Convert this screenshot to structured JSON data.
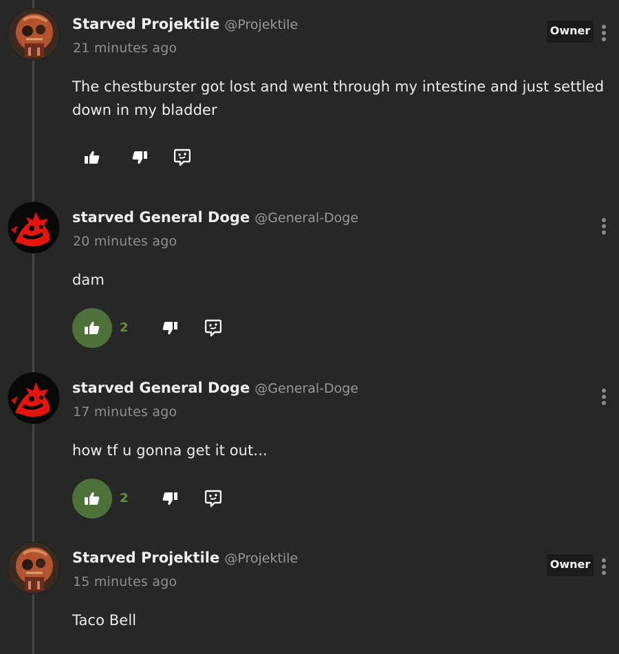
{
  "comments": [
    {
      "display_name": "Starved Projektile",
      "handle": "@Projektile",
      "time": "21 minutes ago",
      "badge": "Owner",
      "text": "The chestburster got lost and went through my intestine and just settled down in my bladder",
      "liked": false,
      "like_count": ""
    },
    {
      "display_name": "starved General Doge",
      "handle": "@General-Doge",
      "time": "20 minutes ago",
      "badge": "",
      "text": "dam",
      "liked": true,
      "like_count": "2"
    },
    {
      "display_name": "starved General Doge",
      "handle": "@General-Doge",
      "time": "17 minutes ago",
      "badge": "",
      "text": "how tf u gonna get it out...",
      "liked": true,
      "like_count": "2"
    },
    {
      "display_name": "Starved Projektile",
      "handle": "@Projektile",
      "time": "15 minutes ago",
      "badge": "Owner",
      "text": "Taco Bell",
      "liked": false,
      "like_count": ""
    }
  ],
  "icons": {
    "like": "thumbs-up-icon",
    "dislike": "thumbs-down-icon",
    "reply": "reply-bubble-icon",
    "menu": "more-vertical-icon"
  },
  "colors": {
    "background": "#272727",
    "liked_bg": "#4c7139",
    "like_count": "#62953f",
    "badge_bg": "#1b1b1b",
    "thread_line": "#454545"
  }
}
